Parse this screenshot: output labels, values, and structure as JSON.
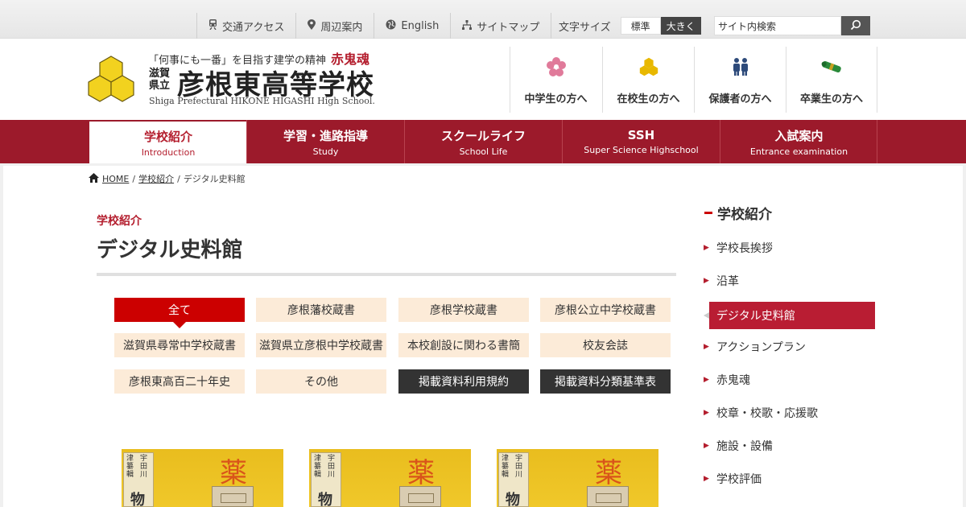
{
  "util_links": [
    {
      "label": "交通アクセス",
      "icon": "train-icon"
    },
    {
      "label": "周辺案内",
      "icon": "map-pin-icon"
    },
    {
      "label": "English",
      "icon": "globe-icon"
    },
    {
      "label": "サイトマップ",
      "icon": "sitemap-icon"
    }
  ],
  "font_size": {
    "label": "文字サイズ",
    "standard": "標準",
    "large": "大きく"
  },
  "search": {
    "value": "サイト内検索"
  },
  "header": {
    "tagline": "「何事にも一番」を目指す建学の精神",
    "tagline_emphasis": "赤鬼魂",
    "prefecture": "滋賀県立",
    "school_name": "彦根東高等学校",
    "school_name_en": "Shiga Prefectural HIKONE HIGASHI High School."
  },
  "audience_links": [
    {
      "label": "中学生の方へ",
      "icon": "cherry-blossom-icon",
      "color": "#e07a9a"
    },
    {
      "label": "在校生の方へ",
      "icon": "school-crest-icon",
      "color": "#e8b800"
    },
    {
      "label": "保護者の方へ",
      "icon": "parents-icon",
      "color": "#2d4a7a"
    },
    {
      "label": "卒業生の方へ",
      "icon": "diploma-icon",
      "color": "#2a8a3a"
    }
  ],
  "main_nav": [
    {
      "jp": "学校紹介",
      "en": "Introduction"
    },
    {
      "jp": "学習・進路指導",
      "en": "Study"
    },
    {
      "jp": "スクールライフ",
      "en": "School Life"
    },
    {
      "jp": "SSH",
      "en": "Super Science Highschool"
    },
    {
      "jp": "入試案内",
      "en": "Entrance examination"
    }
  ],
  "breadcrumb": {
    "home": "HOME",
    "section": "学校紹介",
    "current": "デジタル史料館",
    "sep": "/"
  },
  "page": {
    "section": "学校紹介",
    "title": "デジタル史料館"
  },
  "filters": [
    "全て",
    "彦根藩校蔵書",
    "彦根学校蔵書",
    "彦根公立中学校蔵書",
    "滋賀県尋常中学校蔵書",
    "滋賀県立彦根中学校蔵書",
    "本校創設に関わる書簡",
    "校友会誌",
    "彦根東高百二十年史",
    "その他",
    "掲載資料利用規約",
    "掲載資料分類基準表"
  ],
  "thumbnail": {
    "label_col1": "宇田川",
    "label_col2": "津纂輯",
    "label_big": "物",
    "stamp": "薬"
  },
  "side_nav": {
    "title": "学校紹介",
    "items": [
      "学校長挨拶",
      "沿革",
      "デジタル史料館",
      "アクションプラン",
      "赤鬼魂",
      "校章・校歌・応援歌",
      "施設・設備",
      "学校評価"
    ]
  },
  "colors": {
    "brand_red": "#9c1a2b",
    "accent_red": "#cc0000",
    "filter_beige": "#fcebd8",
    "logo_yellow": "#f2d21f"
  }
}
